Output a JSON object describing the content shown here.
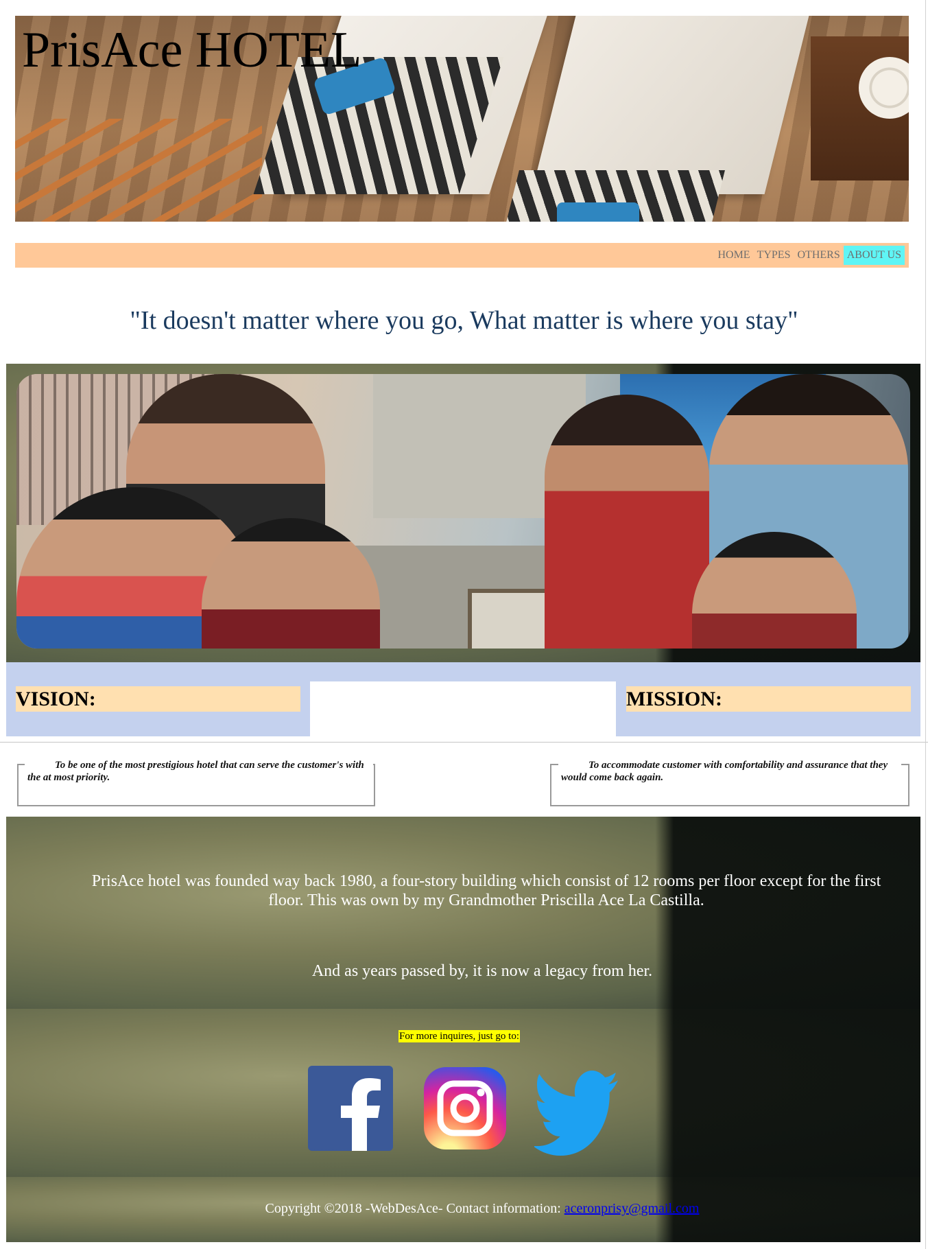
{
  "header": {
    "site_title": "PrisAce HOTEL"
  },
  "nav": {
    "items": [
      {
        "label": "HOME"
      },
      {
        "label": "TYPES"
      },
      {
        "label": "OTHERS"
      },
      {
        "label": "ABOUT US"
      }
    ],
    "active": "ABOUT US"
  },
  "quote": "\"It doesn't matter where you go, What matter is where you stay\"",
  "vision": {
    "heading": "VISION:",
    "text": "To be one of the most prestigious hotel that can serve the customer's with the at most priority."
  },
  "mission": {
    "heading": "MISSION:",
    "text": "To accommodate customer with comfortability and assurance that they would come back again."
  },
  "history": {
    "paragraph1": "PrisAce hotel was founded way back 1980, a four-story building which consist of 12 rooms per floor except for the first floor. This was own by my Grandmother Priscilla Ace La Castilla.",
    "paragraph2": "And as years passed by, it is now a legacy from her."
  },
  "contact": {
    "inquire_label": "For more inquires, just go to:",
    "social": [
      {
        "name": "facebook-icon",
        "color": "#3b5998"
      },
      {
        "name": "instagram-icon",
        "color": "#d6249f"
      },
      {
        "name": "twitter-icon",
        "color": "#1da1f2"
      }
    ]
  },
  "footer": {
    "text": "Copyright ©2018 -WebDesAce- Contact information: ",
    "email": "aceronprisy@gmail.com"
  },
  "colors": {
    "nav_bg": "#ffc898",
    "nav_active": "#5ff5f5",
    "quote": "#1a3a5e",
    "vm_band": "#c4d1ee",
    "vm_heading_bg": "#ffe0b0",
    "inquire_highlight": "#ffff00"
  }
}
